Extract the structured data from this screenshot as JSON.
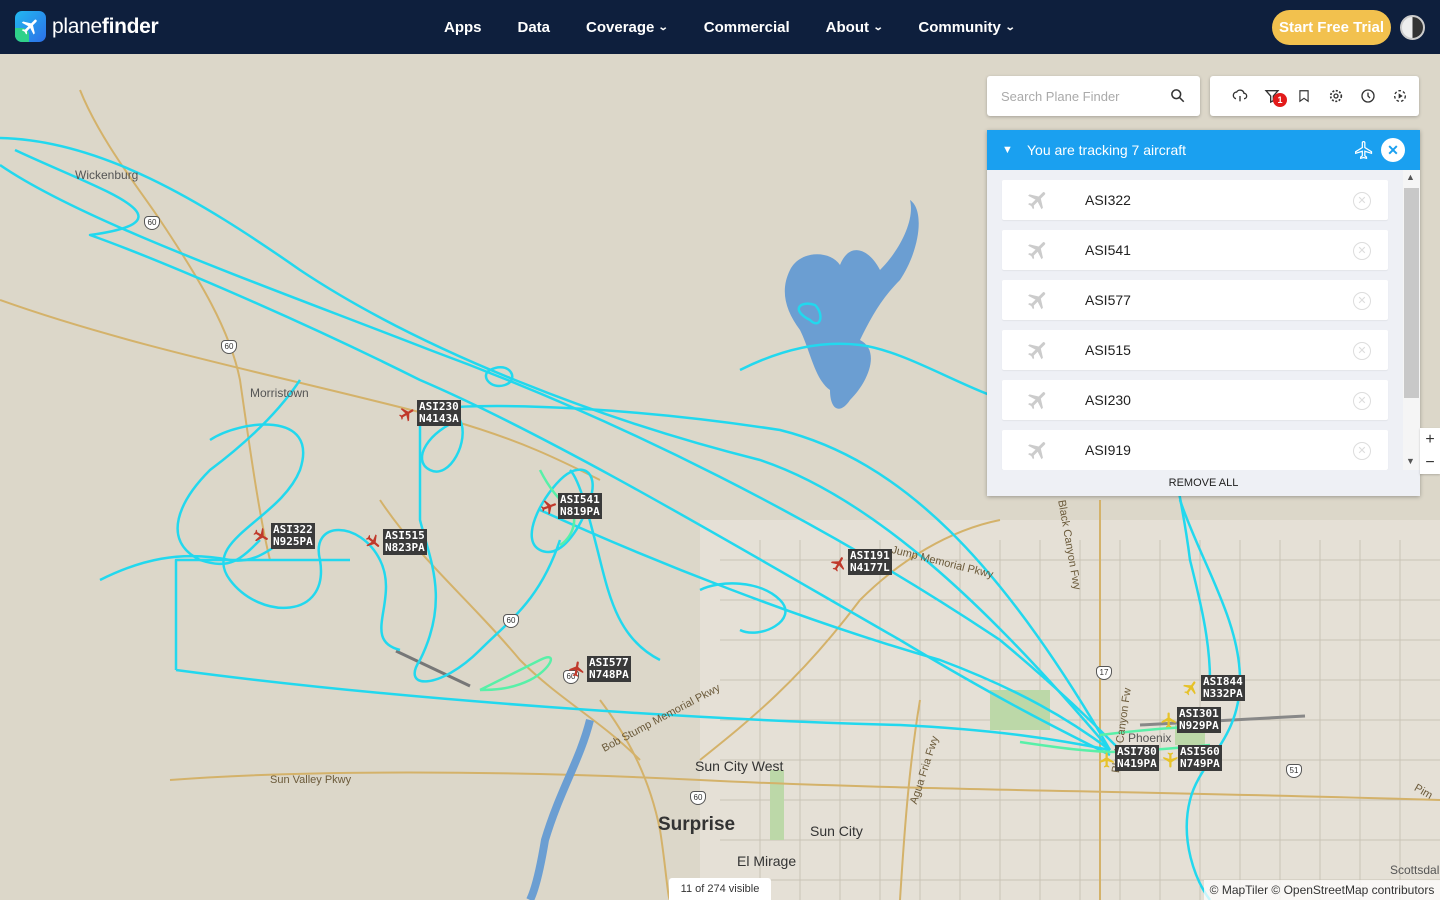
{
  "brand": {
    "name_light": "plane",
    "name_bold": "finder"
  },
  "nav": [
    {
      "label": "Apps",
      "dropdown": false
    },
    {
      "label": "Data",
      "dropdown": false
    },
    {
      "label": "Coverage",
      "dropdown": true
    },
    {
      "label": "Commercial",
      "dropdown": false
    },
    {
      "label": "About",
      "dropdown": true
    },
    {
      "label": "Community",
      "dropdown": true
    }
  ],
  "cta": {
    "label": "Start Free Trial"
  },
  "search": {
    "placeholder": "Search Plane Finder"
  },
  "toolbar": {
    "icons": [
      "weather-icon",
      "filter-icon",
      "bookmark-icon",
      "settings-icon",
      "history-icon",
      "playback-icon"
    ],
    "filter_badge": "1"
  },
  "tracking": {
    "title": "You are tracking 7 aircraft",
    "remove_all": "REMOVE ALL",
    "items": [
      {
        "callsign": "ASI322"
      },
      {
        "callsign": "ASI541"
      },
      {
        "callsign": "ASI577"
      },
      {
        "callsign": "ASI515"
      },
      {
        "callsign": "ASI230"
      },
      {
        "callsign": "ASI919"
      }
    ]
  },
  "map": {
    "places": {
      "wickenburg": "Wickenburg",
      "morristown": "Morristown",
      "surprise": "Surprise",
      "sun_city_west": "Sun City West",
      "sun_city": "Sun City",
      "el_mirage": "El Mirage",
      "phoenix": "Phoenix",
      "scottsdale": "Scottsdal"
    },
    "roads": {
      "sun_valley": "Sun Valley Pkwy",
      "bob_stump": "Bob Stump Memorial Pkwy",
      "carefree": "Jump Memorial Pkwy",
      "black_canyon": "Black Canyon Fwy",
      "black_canyon2": "Black Canyon Fw",
      "agua_fria": "Agua Fria Fwy",
      "pima": "Pim"
    },
    "shields": {
      "us60": "60",
      "i17": "17",
      "sr51": "51"
    },
    "aircraft": [
      {
        "callsign": "ASI230",
        "reg": "N4143A",
        "color": "#c0392b"
      },
      {
        "callsign": "ASI541",
        "reg": "N819PA",
        "color": "#c0392b"
      },
      {
        "callsign": "ASI322",
        "reg": "N925PA",
        "color": "#c0392b"
      },
      {
        "callsign": "ASI515",
        "reg": "N823PA",
        "color": "#c0392b"
      },
      {
        "callsign": "ASI191",
        "reg": "N4177L",
        "color": "#c0392b"
      },
      {
        "callsign": "ASI577",
        "reg": "N748PA",
        "color": "#c0392b"
      },
      {
        "callsign": "ASI844",
        "reg": "N332PA",
        "color": "#e6c229"
      },
      {
        "callsign": "ASI301",
        "reg": "N929PA",
        "color": "#e6c229"
      },
      {
        "callsign": "ASI780",
        "reg": "N419PA",
        "color": "#e6c229"
      },
      {
        "callsign": "ASI560",
        "reg": "N749PA",
        "color": "#e6c229"
      }
    ]
  },
  "footer": {
    "visible_count": "11 of 274 visible",
    "attribution": "© MapTiler © OpenStreetMap contributors"
  },
  "colors": {
    "nav_bg": "#0e1f3d",
    "accent": "#1aa0f0",
    "cta": "#f2c14e",
    "track": "#22d8ee"
  }
}
